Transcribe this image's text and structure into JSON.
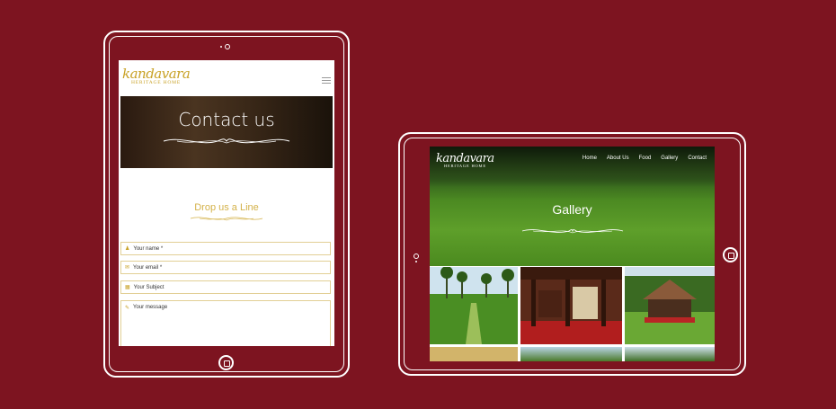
{
  "brand": {
    "name": "kandavara",
    "tagline": "HERITAGE HOME"
  },
  "contact_page": {
    "hero_title": "Contact us",
    "section_title": "Drop us a Line",
    "fields": [
      {
        "icon": "user-icon",
        "placeholder": "Your name *"
      },
      {
        "icon": "mail-icon",
        "placeholder": "Your email *"
      },
      {
        "icon": "subject-icon",
        "placeholder": "Your Subject"
      },
      {
        "icon": "pencil-icon",
        "placeholder": "Your message"
      }
    ]
  },
  "gallery_page": {
    "nav": [
      "Home",
      "About Us",
      "Food",
      "Gallery",
      "Contact"
    ],
    "hero_title": "Gallery",
    "photos": [
      "rice-field-path",
      "red-floor-verandah",
      "thatched-pavilion"
    ]
  },
  "colors": {
    "background": "#7d1420",
    "accent_gold": "#c9a227"
  }
}
